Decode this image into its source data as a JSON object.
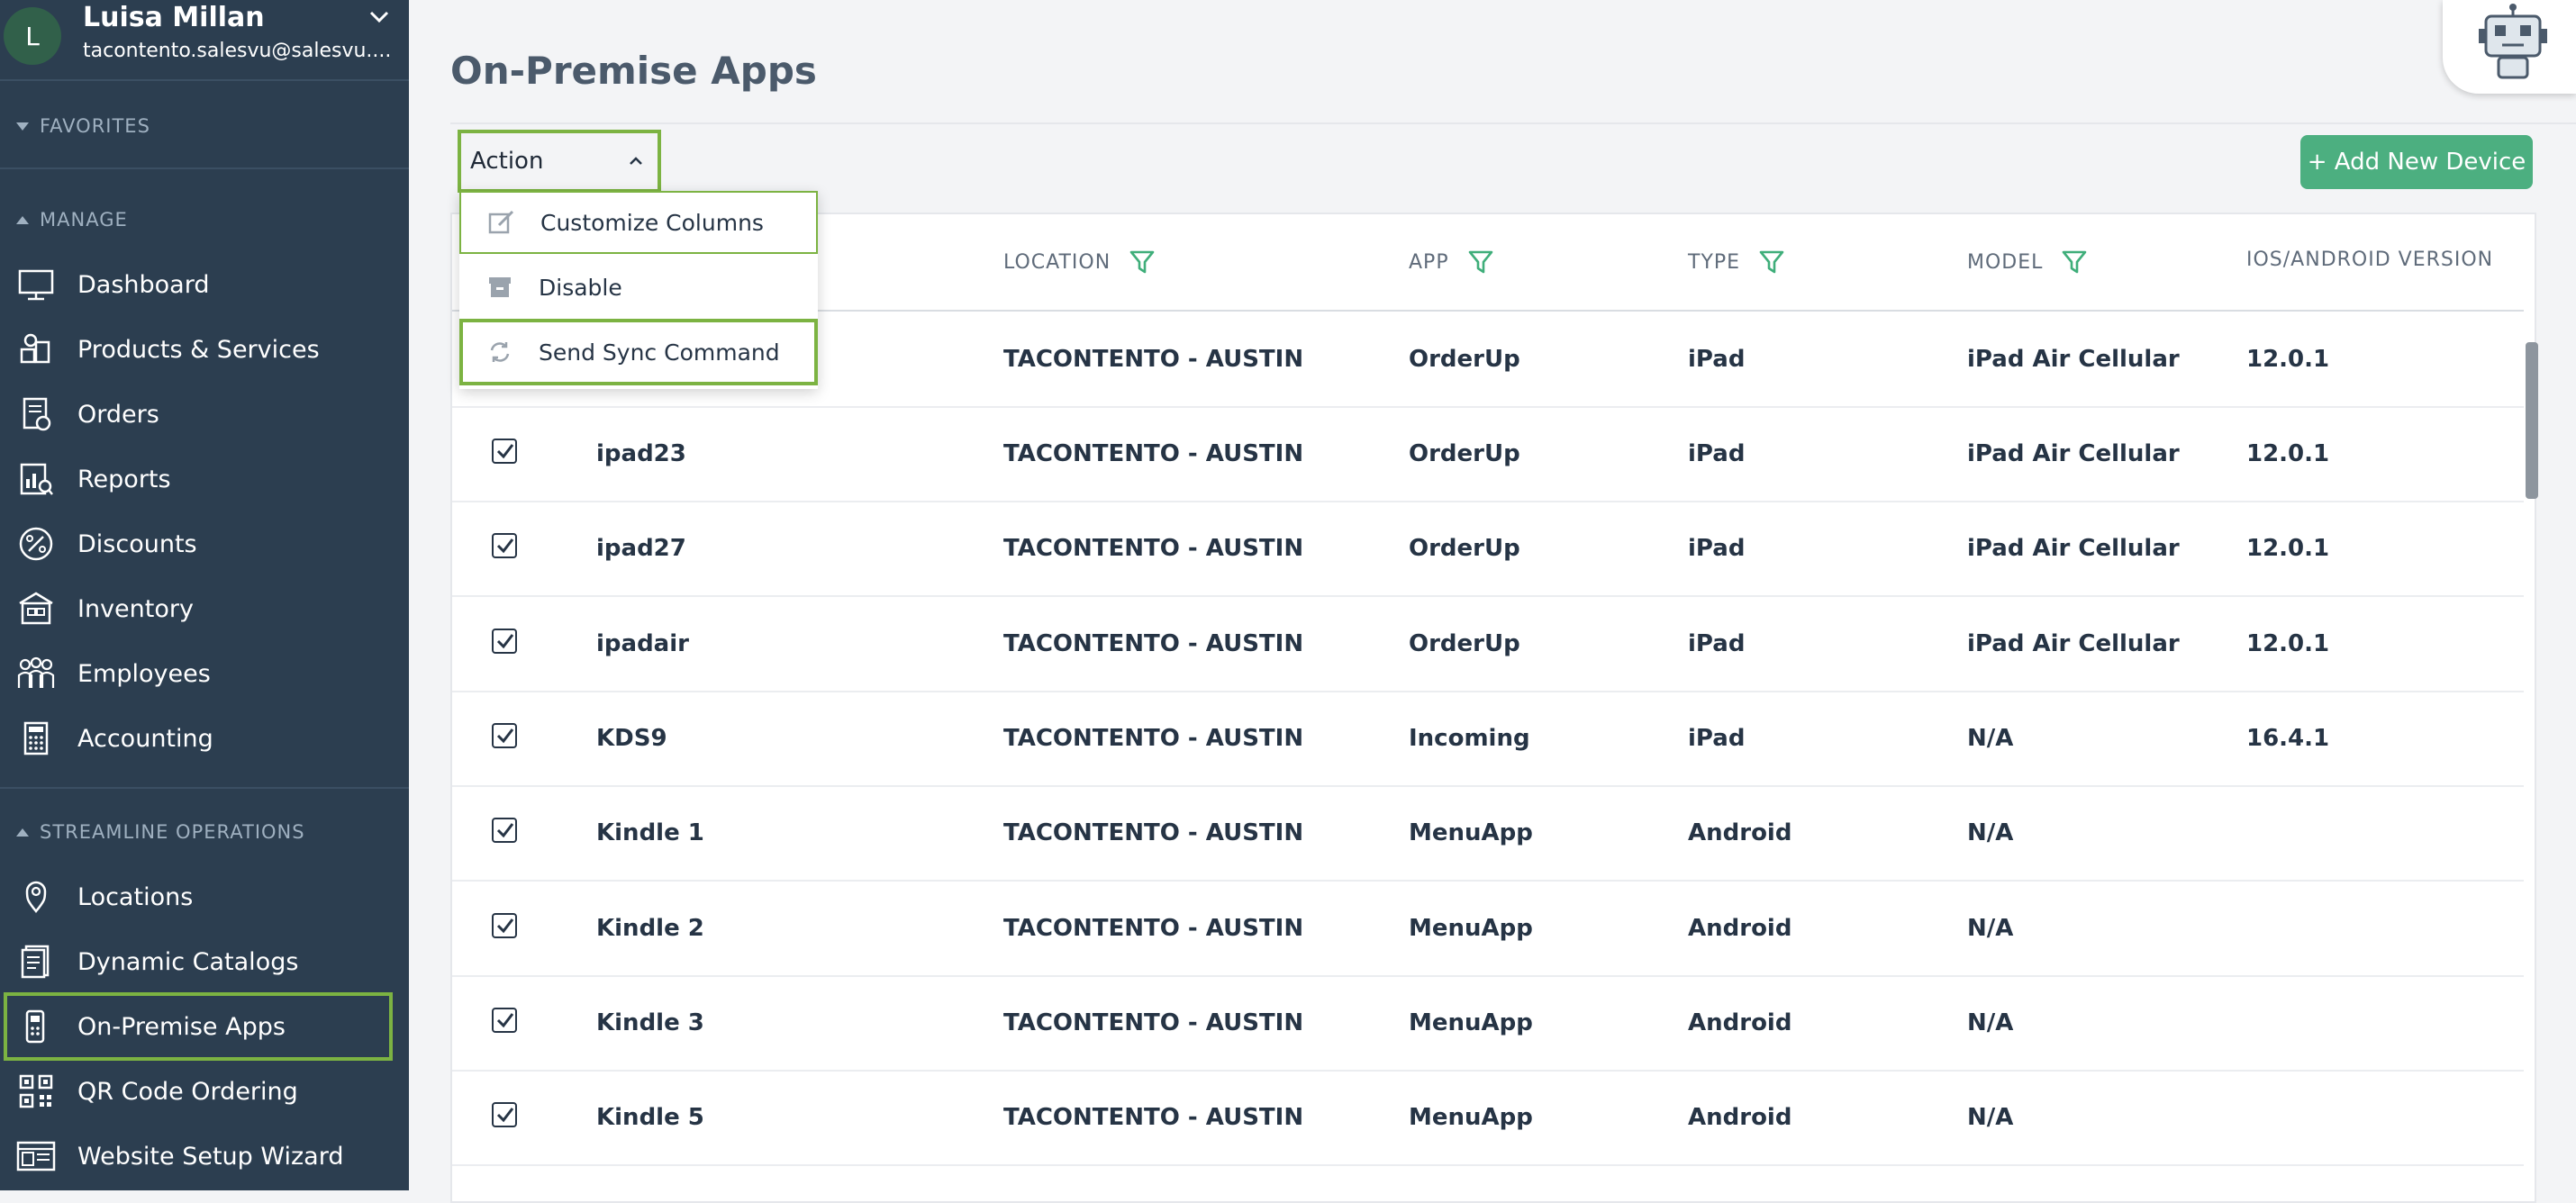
{
  "user": {
    "initial": "L",
    "name": "Luisa Millan",
    "email": "tacontento.salesvu@salesvu...."
  },
  "sidebar": {
    "favorites_label": "FAVORITES",
    "manage_label": "MANAGE",
    "streamline_label": "STREAMLINE OPERATIONS",
    "manage_items": [
      {
        "label": "Dashboard",
        "icon": "monitor-icon"
      },
      {
        "label": "Products & Services",
        "icon": "products-icon"
      },
      {
        "label": "Orders",
        "icon": "orders-icon"
      },
      {
        "label": "Reports",
        "icon": "reports-icon"
      },
      {
        "label": "Discounts",
        "icon": "percent-icon"
      },
      {
        "label": "Inventory",
        "icon": "inventory-icon"
      },
      {
        "label": "Employees",
        "icon": "employees-icon"
      },
      {
        "label": "Accounting",
        "icon": "calculator-icon"
      }
    ],
    "streamline_items": [
      {
        "label": "Locations",
        "icon": "location-pin-icon"
      },
      {
        "label": "Dynamic Catalogs",
        "icon": "catalog-icon"
      },
      {
        "label": "On-Premise Apps",
        "icon": "pos-terminal-icon",
        "active": true
      },
      {
        "label": "QR Code Ordering",
        "icon": "qr-code-icon"
      },
      {
        "label": "Website Setup Wizard",
        "icon": "website-icon"
      }
    ]
  },
  "page": {
    "title": "On-Premise Apps"
  },
  "toolbar": {
    "action_label": "Action",
    "add_label": "+ Add New Device"
  },
  "action_menu": {
    "items": [
      {
        "label": "Customize Columns",
        "icon": "edit-icon"
      },
      {
        "label": "Disable",
        "icon": "archive-icon"
      },
      {
        "label": "Send Sync Command",
        "icon": "sync-icon"
      }
    ]
  },
  "table": {
    "headers": {
      "location": "LOCATION",
      "app": "APP",
      "type": "TYPE",
      "model": "MODEL",
      "version": "IOS/ANDROID VERSION"
    },
    "rows": [
      {
        "name": "",
        "location": "TACONTENTO - AUSTIN",
        "app": "OrderUp",
        "type": "iPad",
        "model": "iPad Air Cellular",
        "version": "12.0.1"
      },
      {
        "name": "ipad23",
        "location": "TACONTENTO - AUSTIN",
        "app": "OrderUp",
        "type": "iPad",
        "model": "iPad Air Cellular",
        "version": "12.0.1"
      },
      {
        "name": "ipad27",
        "location": "TACONTENTO - AUSTIN",
        "app": "OrderUp",
        "type": "iPad",
        "model": "iPad Air Cellular",
        "version": "12.0.1"
      },
      {
        "name": "ipadair",
        "location": "TACONTENTO - AUSTIN",
        "app": "OrderUp",
        "type": "iPad",
        "model": "iPad Air Cellular",
        "version": "12.0.1"
      },
      {
        "name": "KDS9",
        "location": "TACONTENTO - AUSTIN",
        "app": "Incoming",
        "type": "iPad",
        "model": "N/A",
        "version": "16.4.1"
      },
      {
        "name": "Kindle 1",
        "location": "TACONTENTO - AUSTIN",
        "app": "MenuApp",
        "type": "Android",
        "model": "N/A",
        "version": ""
      },
      {
        "name": "Kindle 2",
        "location": "TACONTENTO - AUSTIN",
        "app": "MenuApp",
        "type": "Android",
        "model": "N/A",
        "version": ""
      },
      {
        "name": "Kindle 3",
        "location": "TACONTENTO - AUSTIN",
        "app": "MenuApp",
        "type": "Android",
        "model": "N/A",
        "version": ""
      },
      {
        "name": "Kindle 5",
        "location": "TACONTENTO - AUSTIN",
        "app": "MenuApp",
        "type": "Android",
        "model": "N/A",
        "version": ""
      }
    ]
  },
  "colors": {
    "sidebar_bg": "#2c3e50",
    "accent_green": "#4caf80",
    "highlight_green": "#7cb342",
    "filter_green": "#3fae7a"
  }
}
